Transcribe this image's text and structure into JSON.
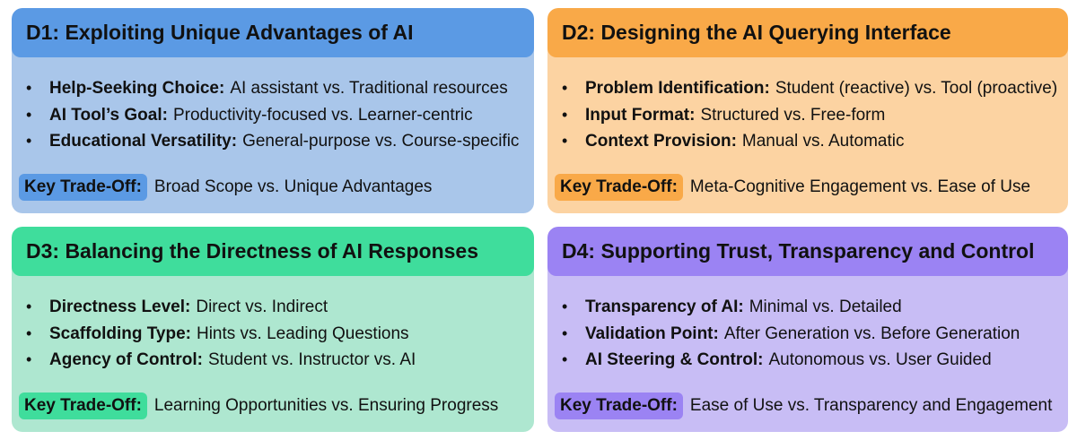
{
  "panels": [
    {
      "title": "D1: Exploiting Unique Advantages of AI",
      "color_header": "#5b9ae4",
      "color_body": "#a9c6ea",
      "items": [
        {
          "term": "Help-Seeking Choice:",
          "text": "AI assistant vs. Traditional resources"
        },
        {
          "term": "AI Tool’s Goal:",
          "text": "Productivity-focused vs. Learner-centric"
        },
        {
          "term": "Educational Versatility:",
          "text": "General-purpose vs. Course-specific"
        }
      ],
      "tradeoff_label": "Key Trade-Off:",
      "tradeoff_text": "Broad Scope vs. Unique Advantages"
    },
    {
      "title": "D2: Designing the AI Querying Interface",
      "color_header": "#f9a948",
      "color_body": "#fcd3a2",
      "items": [
        {
          "term": "Problem Identification:",
          "text": "Student (reactive) vs. Tool (proactive)"
        },
        {
          "term": "Input Format:",
          "text": "Structured vs. Free-form"
        },
        {
          "term": "Context Provision:",
          "text": "Manual vs. Automatic"
        }
      ],
      "tradeoff_label": "Key Trade-Off:",
      "tradeoff_text": "Meta-Cognitive Engagement vs. Ease of Use"
    },
    {
      "title": "D3: Balancing the Directness of AI Responses",
      "color_header": "#3fdd9c",
      "color_body": "#aee7d0",
      "items": [
        {
          "term": "Directness Level:",
          "text": "Direct vs. Indirect"
        },
        {
          "term": "Scaffolding Type:",
          "text": "Hints vs. Leading Questions"
        },
        {
          "term": "Agency of Control:",
          "text": "Student vs. Instructor vs. AI"
        }
      ],
      "tradeoff_label": "Key Trade-Off:",
      "tradeoff_text": "Learning Opportunities vs. Ensuring Progress"
    },
    {
      "title": "D4: Supporting Trust, Transparency and Control",
      "color_header": "#9b83f3",
      "color_body": "#c8bdf5",
      "items": [
        {
          "term": "Transparency of AI:",
          "text": "Minimal vs. Detailed"
        },
        {
          "term": "Validation Point:",
          "text": "After Generation vs. Before Generation"
        },
        {
          "term": "AI Steering & Control:",
          "text": "Autonomous vs. User Guided"
        }
      ],
      "tradeoff_label": "Key Trade-Off:",
      "tradeoff_text": "Ease of Use vs. Transparency and Engagement"
    }
  ]
}
